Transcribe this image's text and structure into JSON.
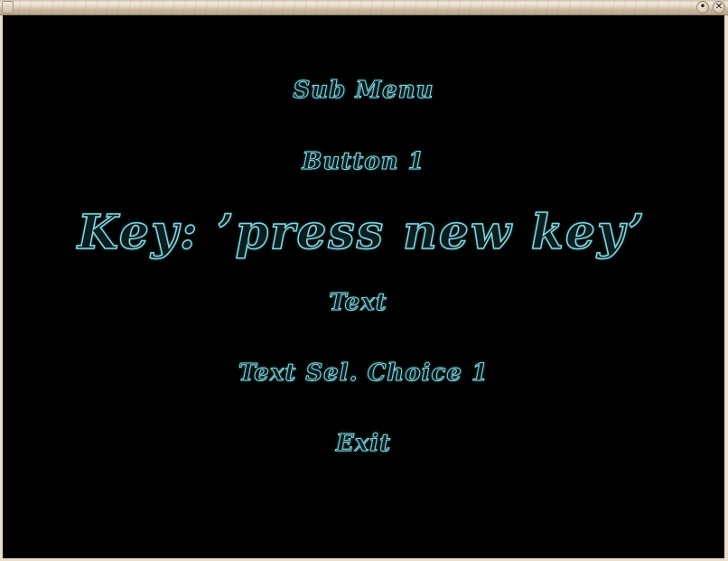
{
  "window": {
    "title": "",
    "buttons": [
      {
        "name": "shade",
        "glyph": "•"
      },
      {
        "name": "close",
        "glyph": "✕"
      }
    ]
  },
  "menu": {
    "items": [
      {
        "label": "Sub Menu"
      },
      {
        "label": "Button 1"
      },
      {
        "label": "Key: ’press new key’"
      },
      {
        "label": "Text"
      },
      {
        "label": "Text Sel. Choice 1"
      },
      {
        "label": "Exit"
      }
    ]
  },
  "colors": {
    "background": "#000000",
    "text_glow": "#8fd4dc",
    "frame": "#e9ddcc"
  }
}
